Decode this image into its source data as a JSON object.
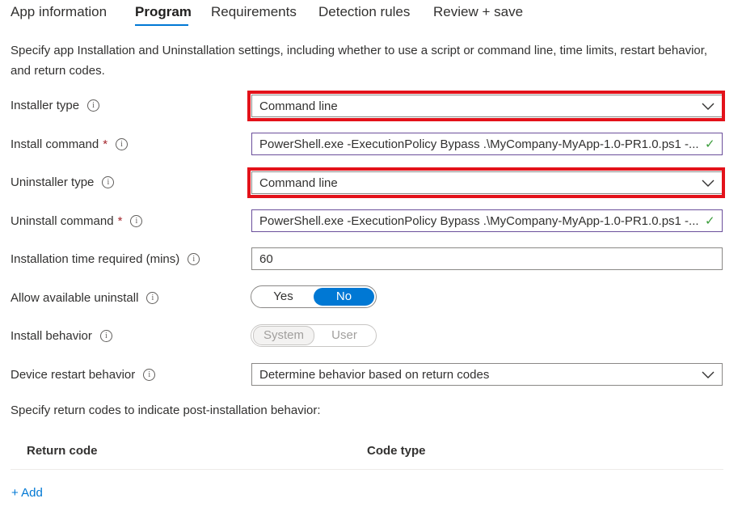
{
  "tabs": [
    {
      "label": "App information"
    },
    {
      "label": "Program"
    },
    {
      "label": "Requirements"
    },
    {
      "label": "Detection rules"
    },
    {
      "label": "Review + save"
    }
  ],
  "active_tab": "Program",
  "description": "Specify app Installation and Uninstallation settings, including whether to use a script or command line, time limits, restart behavior, and return codes.",
  "fields": {
    "installer_type": {
      "label": "Installer type",
      "value": "Command line"
    },
    "install_command": {
      "label": "Install command",
      "required": "*",
      "value": "PowerShell.exe -ExecutionPolicy Bypass .\\MyCompany-MyApp-1.0-PR1.0.ps1 -..."
    },
    "uninstaller_type": {
      "label": "Uninstaller type",
      "value": "Command line"
    },
    "uninstall_command": {
      "label": "Uninstall command",
      "required": "*",
      "value": "PowerShell.exe -ExecutionPolicy Bypass .\\MyCompany-MyApp-1.0-PR1.0.ps1 -..."
    },
    "install_time": {
      "label": "Installation time required (mins)",
      "value": "60"
    },
    "allow_uninstall": {
      "label": "Allow available uninstall",
      "options": [
        "Yes",
        "No"
      ],
      "selected": "No"
    },
    "install_behavior": {
      "label": "Install behavior",
      "options": [
        "System",
        "User"
      ],
      "selected": "System"
    },
    "restart_behavior": {
      "label": "Device restart behavior",
      "value": "Determine behavior based on return codes"
    }
  },
  "return_codes": {
    "title": "Specify return codes to indicate post-installation behavior:",
    "columns": [
      "Return code",
      "Code type"
    ],
    "add_label": "+ Add"
  },
  "info_glyph": "i",
  "check_glyph": "✓",
  "colors": {
    "accent": "#0078d4",
    "highlight": "#e3121a",
    "valid_border": "#6b4f9b",
    "check": "#3a9c3a"
  }
}
